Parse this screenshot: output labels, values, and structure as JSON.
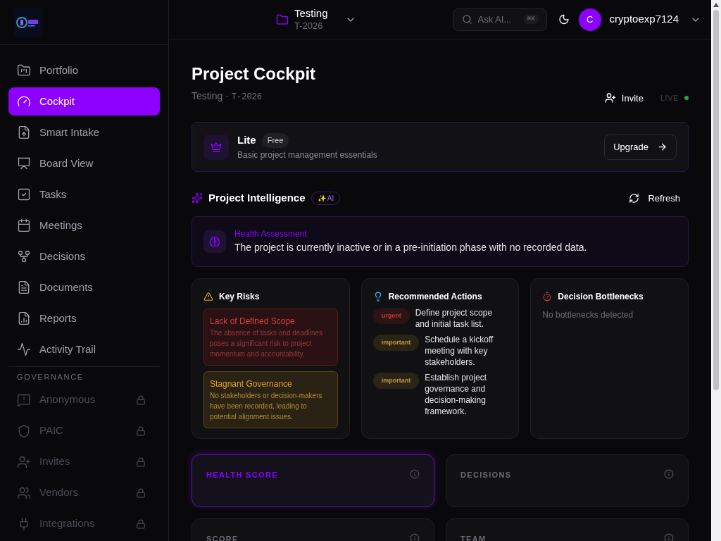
{
  "sidebar": {
    "items": [
      {
        "label": "Portfolio",
        "selected": false,
        "locked": false
      },
      {
        "label": "Cockpit",
        "selected": true,
        "locked": false
      },
      {
        "label": "Smart Intake",
        "selected": false,
        "locked": false
      },
      {
        "label": "Board View",
        "selected": false,
        "locked": false
      },
      {
        "label": "Tasks",
        "selected": false,
        "locked": false
      },
      {
        "label": "Meetings",
        "selected": false,
        "locked": false
      },
      {
        "label": "Decisions",
        "selected": false,
        "locked": false
      },
      {
        "label": "Documents",
        "selected": false,
        "locked": false
      },
      {
        "label": "Reports",
        "selected": false,
        "locked": false
      },
      {
        "label": "Activity Trail",
        "selected": false,
        "locked": false
      }
    ],
    "section_title": "GOVERNANCE",
    "section_items": [
      {
        "label": "Anonymous",
        "selected": false,
        "locked": true
      },
      {
        "label": "PAIC",
        "selected": false,
        "locked": true
      },
      {
        "label": "Invites",
        "selected": false,
        "locked": true
      },
      {
        "label": "Vendors",
        "selected": false,
        "locked": true
      },
      {
        "label": "Integrations",
        "selected": false,
        "locked": true
      }
    ]
  },
  "header": {
    "project_name": "Testing",
    "project_code": "T-2026",
    "search_placeholder": "Ask AI...",
    "shortcut": "⌘K",
    "avatar_initial": "C",
    "username": "cryptoexp7124"
  },
  "page": {
    "title": "Project Cockpit",
    "subtitle": "Testing · ",
    "code": "T-2026",
    "invite": "Invite",
    "live_label": "LIVE",
    "live": true
  },
  "plan": {
    "name": "Lite",
    "badge": "Free",
    "description": "Basic project management essentials",
    "button": "Upgrade"
  },
  "intelligence": {
    "title": "Project Intelligence",
    "badge": "✨ AI",
    "refresh": "Refresh",
    "assessment": {
      "title": "Health Assessment",
      "text": "The project is currently inactive or in a pre-initiation phase with no recorded data."
    },
    "risks": {
      "title": "Key Risks",
      "items": [
        {
          "kind": "high",
          "title": "Lack of Defined Scope",
          "text": "The absence of tasks and deadlines poses a significant risk to project momentum and accountability."
        },
        {
          "kind": "medium",
          "title": "Stagnant Governance",
          "text": "No stakeholders or decision-makers have been recorded, leading to potential alignment issues."
        }
      ]
    },
    "actions": {
      "title": "Recommended Actions",
      "items": [
        {
          "kind": "urgent",
          "tag": "urgent",
          "text": "Define project scope and initial task list."
        },
        {
          "kind": "important",
          "tag": "important",
          "text": "Schedule a kickoff meeting with key stakeholders."
        },
        {
          "kind": "important",
          "tag": "important",
          "text": "Establish project governance and decision-making framework."
        }
      ]
    },
    "bottlenecks": {
      "title": "Decision Bottlenecks",
      "empty": "No bottlenecks detected"
    }
  },
  "metrics": [
    {
      "label": "HEALTH SCORE",
      "highlighted": true
    },
    {
      "label": "DECISIONS",
      "highlighted": false
    },
    {
      "label": "SCORE",
      "highlighted": false
    },
    {
      "label": "TEAM",
      "highlighted": false
    }
  ]
}
